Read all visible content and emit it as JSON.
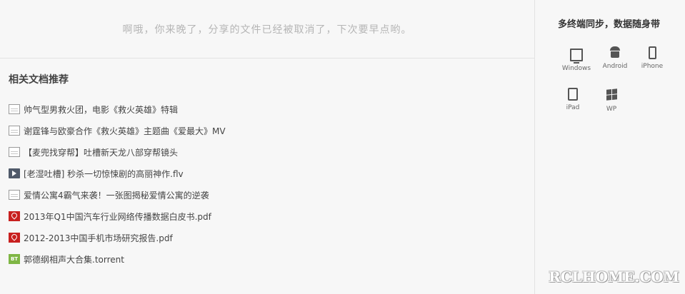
{
  "notice": "啊哦，你来晚了，分享的文件已经被取消了，下次要早点哟。",
  "recommend": {
    "title": "相关文档推荐",
    "items": [
      {
        "icon": "doc-icon",
        "name": "帅气型男救火团，电影《救火英雄》特辑"
      },
      {
        "icon": "doc-icon",
        "name": "谢霆锋与欧豪合作《救火英雄》主题曲《爱最大》MV"
      },
      {
        "icon": "doc-icon",
        "name": "【麦兜找穿帮】吐槽新天龙八部穿帮镜头"
      },
      {
        "icon": "video-icon",
        "name": "[老湿吐槽] 秒杀一切惊悚剧的高丽神作.flv"
      },
      {
        "icon": "doc-icon",
        "name": "爱情公寓4霸气来袭！一张图揭秘爱情公寓的逆袭"
      },
      {
        "icon": "pdf-icon",
        "name": "2013年Q1中国汽车行业网络传播数据白皮书.pdf"
      },
      {
        "icon": "pdf-icon",
        "name": "2012-2013中国手机市场研究报告.pdf"
      },
      {
        "icon": "bt-icon",
        "name": "郭德纲相声大合集.torrent"
      }
    ]
  },
  "sync": {
    "title": "多终端同步，数据随身带",
    "devices": [
      "Windows",
      "Android",
      "iPhone",
      "iPad",
      "WP"
    ]
  },
  "bt_icon_text": "BT",
  "watermark": "RCLHOME.COM"
}
